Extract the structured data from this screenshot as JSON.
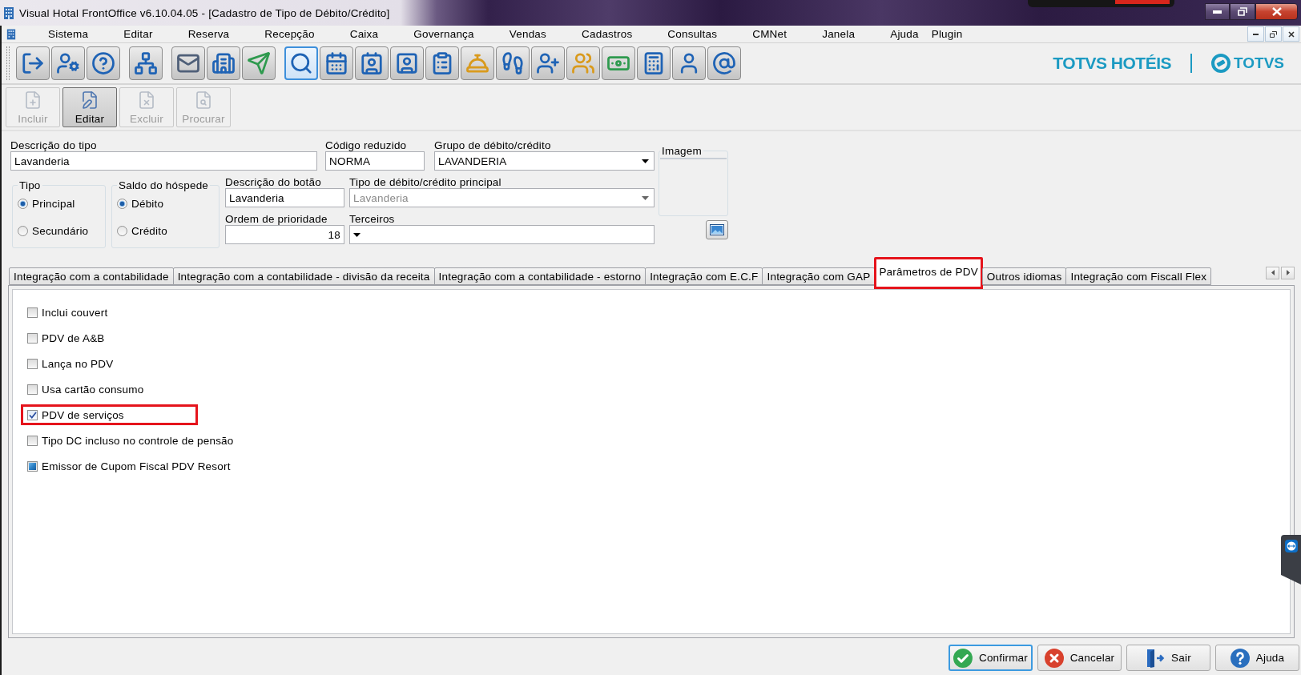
{
  "window": {
    "title": "Visual Hotal FrontOffice v6.10.04.05 - [Cadastro de Tipo de Débito/Crédito]"
  },
  "menu": [
    "Sistema",
    "Editar",
    "Reserva",
    "Recepção",
    "Caixa",
    "Governança",
    "Vendas",
    "Cadastros",
    "Consultas",
    "CMNet",
    "Janela",
    "Ajuda",
    "Plugin"
  ],
  "toolbar": {
    "groups": [
      {
        "buttons": [
          {
            "selected": false
          },
          {
            "selected": false
          },
          {
            "selected": false
          }
        ]
      },
      {
        "buttons": [
          {
            "selected": false
          }
        ]
      },
      {
        "buttons": [
          {
            "selected": false
          },
          {
            "selected": false
          },
          {
            "selected": false
          }
        ]
      },
      {
        "buttons": [
          {
            "selected": true
          },
          {
            "selected": false
          },
          {
            "selected": false
          },
          {
            "selected": false
          },
          {
            "selected": false
          },
          {
            "selected": false
          },
          {
            "selected": false
          },
          {
            "selected": false
          },
          {
            "selected": false
          },
          {
            "selected": false
          },
          {
            "selected": false
          },
          {
            "selected": false
          },
          {
            "selected": false
          }
        ]
      }
    ]
  },
  "brand": {
    "product": "TOTVS HOTÉIS",
    "company": "TOTVS"
  },
  "actions": [
    {
      "label": "Incluir",
      "disabled": true,
      "selected": false
    },
    {
      "label": "Editar",
      "disabled": false,
      "selected": true
    },
    {
      "label": "Excluir",
      "disabled": true,
      "selected": false
    },
    {
      "label": "Procurar",
      "disabled": true,
      "selected": false
    }
  ],
  "form": {
    "type_description": {
      "label": "Descrição do tipo",
      "value": "Lavanderia"
    },
    "short_code": {
      "label": "Código reduzido",
      "value": "NORMA"
    },
    "debit_credit_group": {
      "label": "Grupo de débito/crédito",
      "value": "LAVANDERIA",
      "disabled": false
    },
    "type": {
      "title": "Tipo",
      "options": [
        {
          "label": "Principal",
          "selected": true
        },
        {
          "label": "Secundário",
          "selected": false
        }
      ]
    },
    "guest_balance": {
      "title": "Saldo do hóspede",
      "options": [
        {
          "label": "Débito",
          "selected": true
        },
        {
          "label": "Crédito",
          "selected": false
        }
      ]
    },
    "button_description": {
      "label": "Descrição do botão",
      "value": "Lavanderia"
    },
    "main_type": {
      "label": "Tipo de débito/crédito principal",
      "value": "Lavanderia",
      "disabled": true
    },
    "priority_order": {
      "label": "Ordem de prioridade",
      "value": "18"
    },
    "third_parties": {
      "label": "Terceiros",
      "disabled": false
    },
    "image": {
      "title": "Imagem"
    }
  },
  "tabs": [
    {
      "label": "Integração com a contabilidade",
      "selected": false,
      "highlighted": false
    },
    {
      "label": "Integração com a contabilidade - divisão da receita",
      "selected": false,
      "highlighted": false
    },
    {
      "label": "Integração com a contabilidade - estorno",
      "selected": false,
      "highlighted": false
    },
    {
      "label": "Integração com E.C.F",
      "selected": false,
      "highlighted": false
    },
    {
      "label": "Integração com GAP",
      "selected": false,
      "highlighted": false
    },
    {
      "label": "Parâmetros de PDV",
      "selected": true,
      "highlighted": true
    },
    {
      "label": "Outros idiomas",
      "selected": false,
      "highlighted": false
    },
    {
      "label": "Integração com Fiscall Flex",
      "selected": false,
      "highlighted": false
    }
  ],
  "pdv_options": [
    {
      "label": "Inclui couvert",
      "checked": false,
      "indeterminate": false,
      "highlighted": false
    },
    {
      "label": "PDV de A&B",
      "checked": false,
      "indeterminate": false,
      "highlighted": false
    },
    {
      "label": "Lança no PDV",
      "checked": false,
      "indeterminate": false,
      "highlighted": false
    },
    {
      "label": "Usa cartão consumo",
      "checked": false,
      "indeterminate": false,
      "highlighted": false
    },
    {
      "label": "PDV de serviços",
      "checked": true,
      "indeterminate": false,
      "highlighted": true
    },
    {
      "label": "Tipo DC incluso no controle de pensão",
      "checked": false,
      "indeterminate": false,
      "highlighted": false
    },
    {
      "label": "Emissor de Cupom Fiscal PDV Resort",
      "checked": false,
      "indeterminate": true,
      "highlighted": false
    }
  ],
  "buttons": [
    {
      "label": "Confirmar",
      "kind": "confirm",
      "focused": true
    },
    {
      "label": "Cancelar",
      "kind": "cancel",
      "focused": false
    },
    {
      "label": "Sair",
      "kind": "exit",
      "focused": false
    },
    {
      "label": "Ajuda",
      "kind": "help",
      "focused": false
    }
  ]
}
